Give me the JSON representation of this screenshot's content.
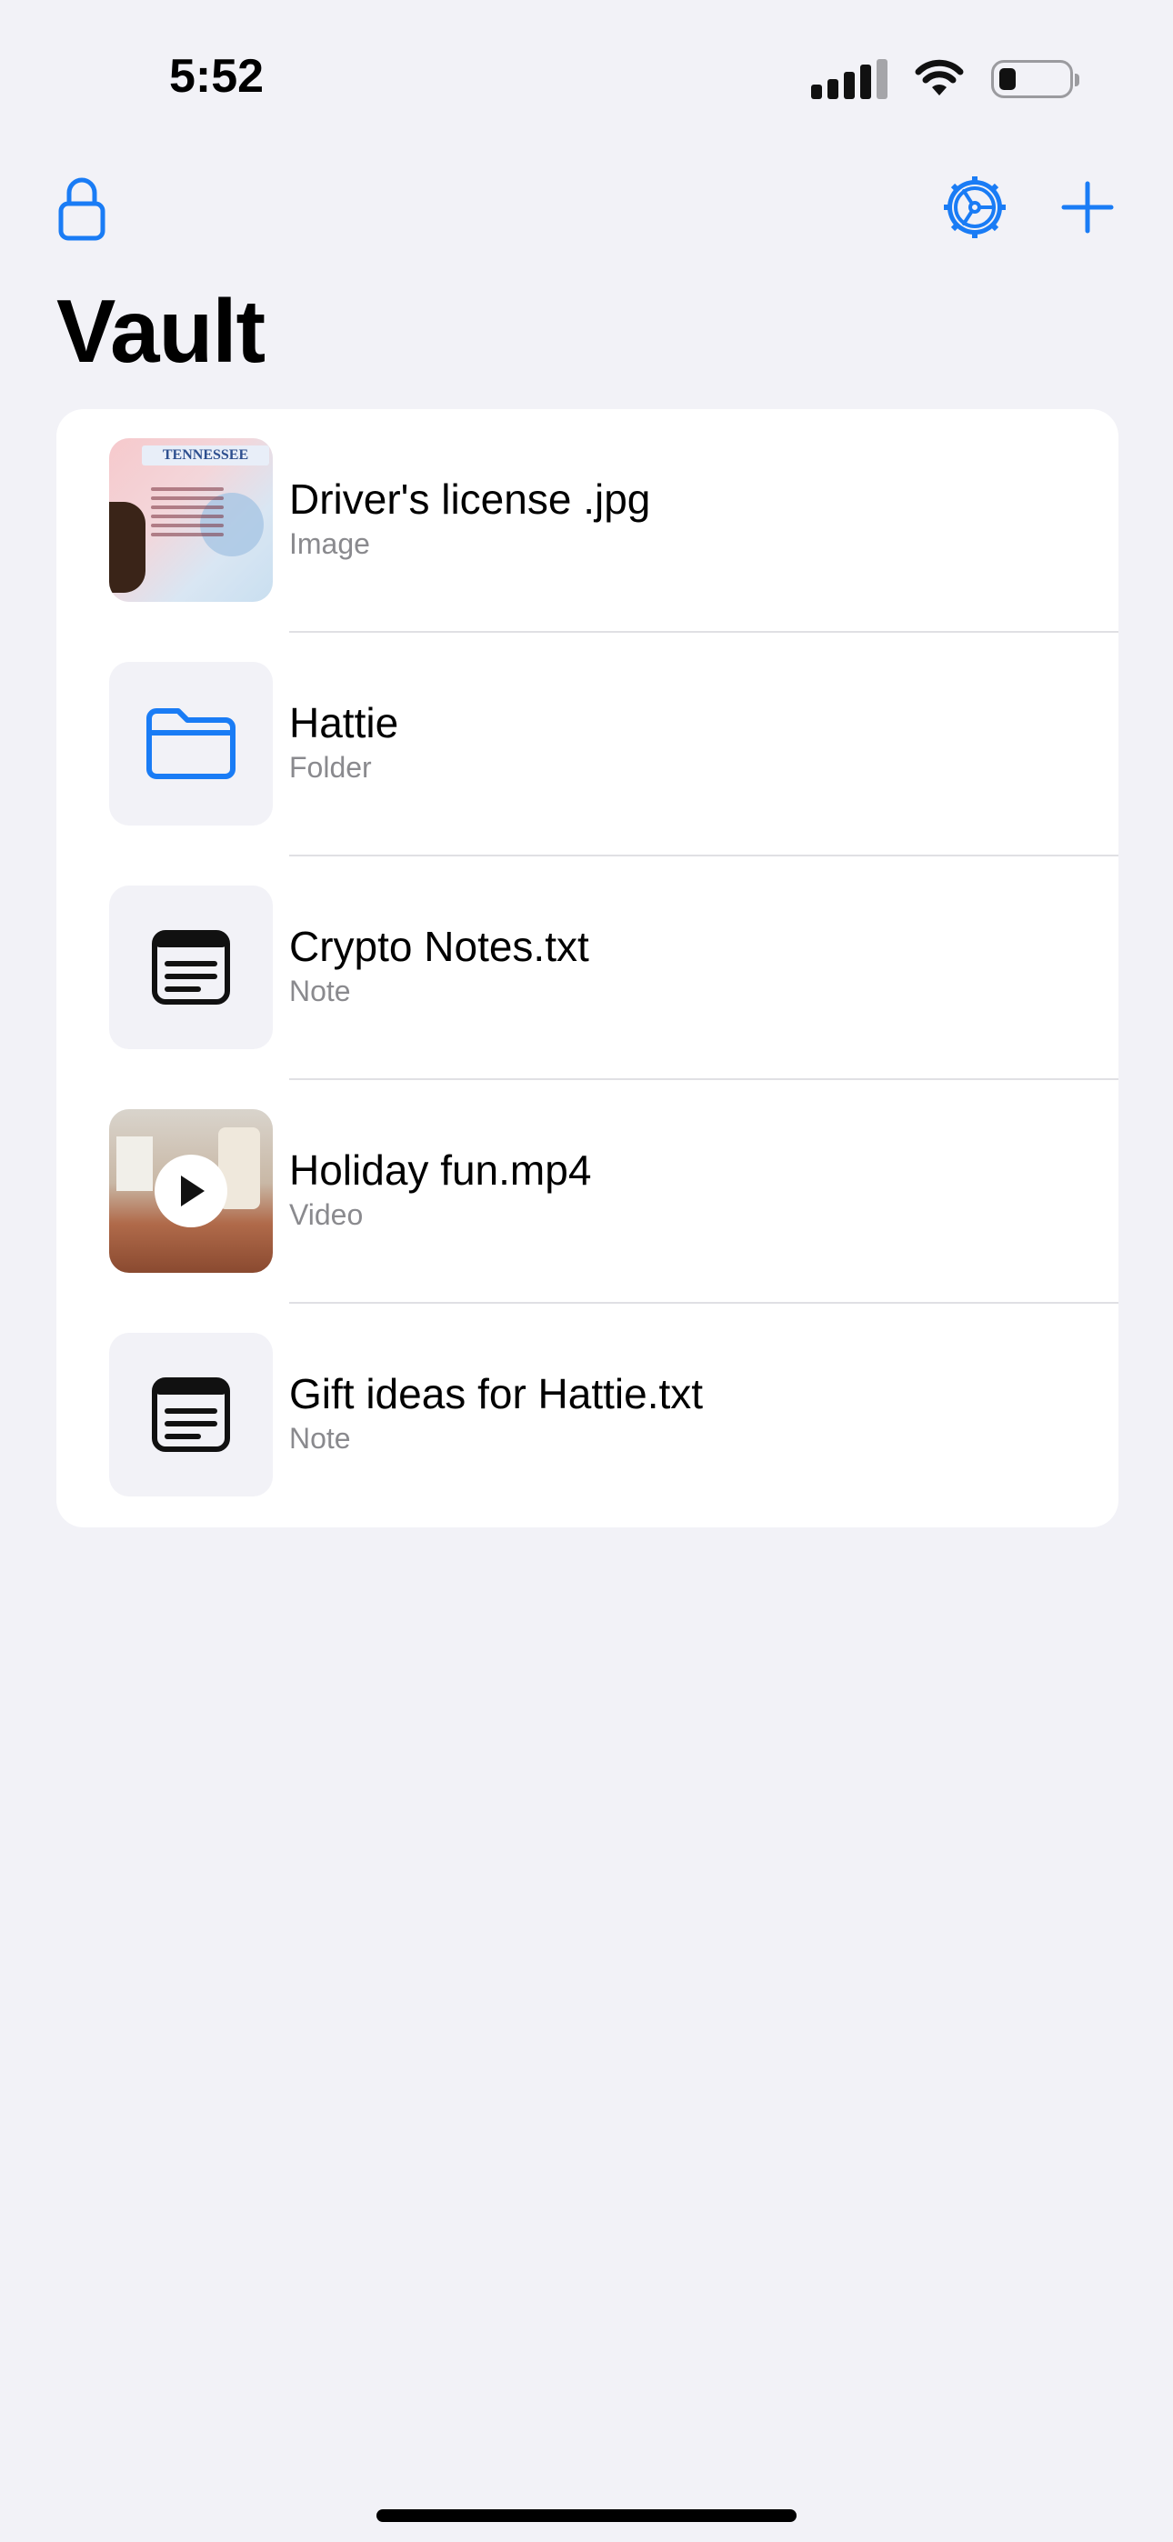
{
  "status_bar": {
    "time": "5:52"
  },
  "nav": {
    "lock_icon": "lock-icon",
    "settings_icon": "gear-icon",
    "add_icon": "plus-icon"
  },
  "page": {
    "title": "Vault"
  },
  "items": [
    {
      "title": "Driver's license .jpg",
      "subtitle": "Image",
      "kind": "image",
      "thumb_heading": "TENNESSEE"
    },
    {
      "title": "Hattie",
      "subtitle": "Folder",
      "kind": "folder"
    },
    {
      "title": "Crypto Notes.txt",
      "subtitle": "Note",
      "kind": "note"
    },
    {
      "title": "Holiday fun.mp4",
      "subtitle": "Video",
      "kind": "video"
    },
    {
      "title": "Gift ideas for Hattie.txt",
      "subtitle": "Note",
      "kind": "note"
    }
  ],
  "colors": {
    "accent": "#1a7cf5",
    "background": "#f2f2f7",
    "secondary_text": "#8a8a8e"
  }
}
